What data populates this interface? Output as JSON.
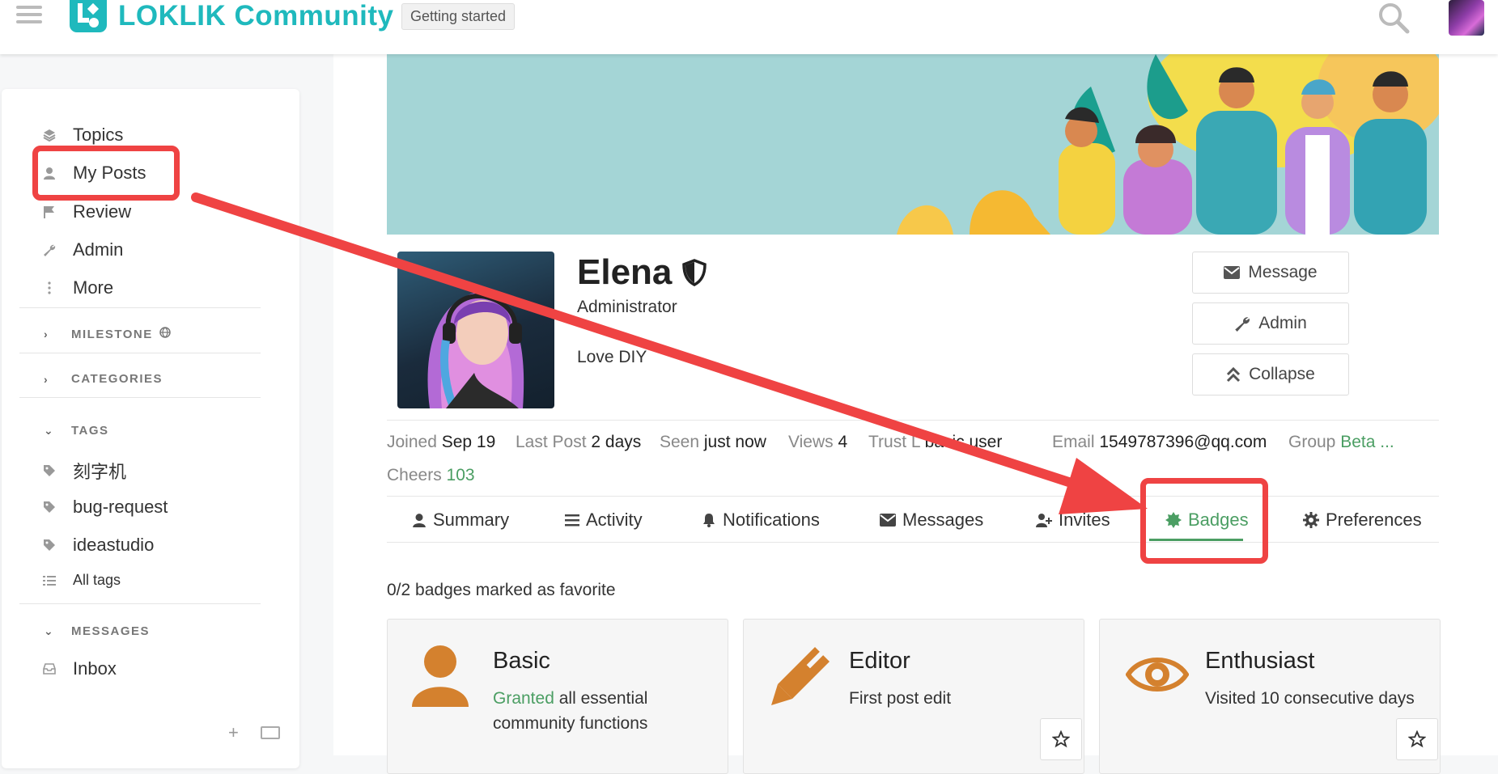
{
  "header": {
    "site_name": "LOKLIK Community",
    "getting_started": "Getting started",
    "brand_color": "#1fb9bd"
  },
  "sidebar": {
    "items": [
      {
        "label": "Topics",
        "icon": "layers-icon"
      },
      {
        "label": "My Posts",
        "icon": "user-icon"
      },
      {
        "label": "Review",
        "icon": "flag-icon"
      },
      {
        "label": "Admin",
        "icon": "wrench-icon"
      },
      {
        "label": "More",
        "icon": "vertical-dots-icon"
      }
    ],
    "sections": {
      "milestone": "MILESTONE",
      "categories": "CATEGORIES",
      "tags": "TAGS",
      "messages": "MESSAGES"
    },
    "tags": [
      "刻字机",
      "bug-request",
      "ideastudio"
    ],
    "all_tags": "All tags",
    "inbox": "Inbox",
    "add_symbol": "+"
  },
  "profile": {
    "name": "Elena",
    "title": "Administrator",
    "bio": "Love DIY",
    "buttons": {
      "message": "Message",
      "admin": "Admin",
      "collapse": "Collapse"
    }
  },
  "stats": {
    "joined_label": "Joined",
    "joined_value": "Sep 19",
    "last_post_label": "Last Post",
    "last_post_value": "2 days",
    "seen_label": "Seen",
    "seen_value": "just now",
    "views_label": "Views",
    "views_value": "4",
    "trust_label": "Trust L",
    "trust_value": "basic user",
    "email_label": "Email",
    "email_value": "1549787396@qq.com",
    "group_label": "Group",
    "group_value": "Beta ...",
    "cheers_label": "Cheers",
    "cheers_value": "103"
  },
  "tabs": [
    {
      "label": "Summary",
      "icon": "user-icon"
    },
    {
      "label": "Activity",
      "icon": "list-icon"
    },
    {
      "label": "Notifications",
      "icon": "bell-icon"
    },
    {
      "label": "Messages",
      "icon": "envelope-icon"
    },
    {
      "label": "Invites",
      "icon": "user-plus-icon"
    },
    {
      "label": "Badges",
      "icon": "certificate-icon",
      "active": true
    },
    {
      "label": "Preferences",
      "icon": "gear-icon"
    }
  ],
  "badges": {
    "summary": "0/2 badges marked as favorite",
    "cards": [
      {
        "title": "Basic",
        "desc_highlight": "Granted",
        "desc": " all essential community functions",
        "icon": "user-icon"
      },
      {
        "title": "Editor",
        "desc": "First post edit",
        "icon": "pencil-icon"
      },
      {
        "title": "Enthusiast",
        "desc": "Visited 10 consecutive days",
        "icon": "eye-icon"
      }
    ]
  },
  "colors": {
    "accent_green": "#4b9e63",
    "badge_orange": "#d4812e",
    "annotation_red": "#ef4343",
    "banner_teal": "#a4d5d6"
  }
}
